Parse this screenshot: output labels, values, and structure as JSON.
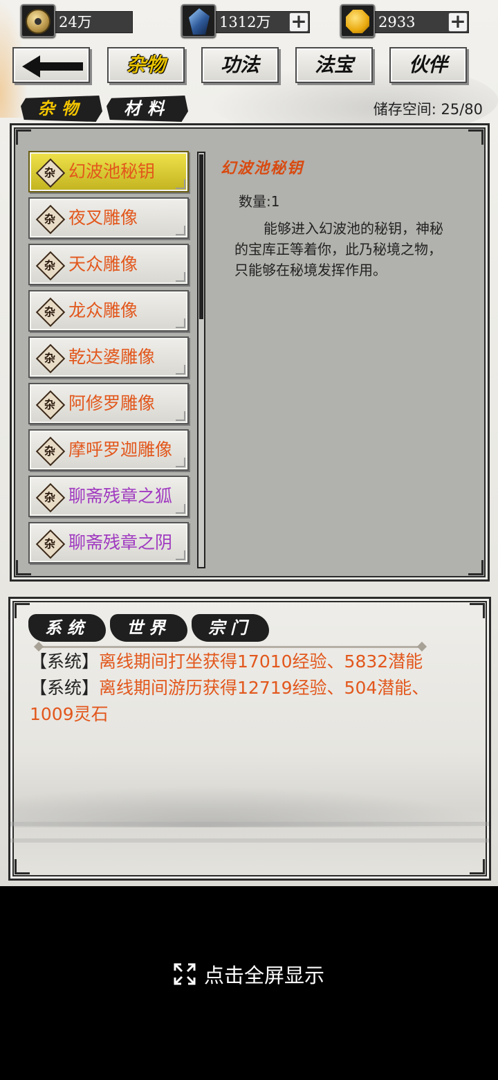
{
  "currency": {
    "coins": {
      "amount": "24万",
      "icon": "yinyang-coin-icon"
    },
    "crystals": {
      "amount": "1312万",
      "icon": "blue-crystal-icon",
      "add": "+"
    },
    "gems": {
      "amount": "2933",
      "icon": "gold-gem-icon",
      "add": "+"
    }
  },
  "top_tabs": [
    {
      "label": "",
      "icon": "back-arrow-icon"
    },
    {
      "label": "杂物",
      "active": true
    },
    {
      "label": "功法"
    },
    {
      "label": "法宝"
    },
    {
      "label": "伙伴"
    }
  ],
  "sub_tabs": [
    {
      "label": "杂物",
      "active": true
    },
    {
      "label": "材料"
    }
  ],
  "storage": "储存空间: 25/80",
  "items": [
    {
      "badge": "杂",
      "name": "幻波池秘钥",
      "selected": true,
      "color": "#e2571c"
    },
    {
      "badge": "杂",
      "name": "夜叉雕像",
      "color": "#e2571c"
    },
    {
      "badge": "杂",
      "name": "天众雕像",
      "color": "#e2571c"
    },
    {
      "badge": "杂",
      "name": "龙众雕像",
      "color": "#e2571c"
    },
    {
      "badge": "杂",
      "name": "乾达婆雕像",
      "color": "#e2571c"
    },
    {
      "badge": "杂",
      "name": "阿修罗雕像",
      "color": "#e2571c"
    },
    {
      "badge": "杂",
      "name": "摩呼罗迦雕像",
      "color": "#e2571c"
    },
    {
      "badge": "杂",
      "name": "聊斋残章之狐",
      "color": "#a03ac0"
    },
    {
      "badge": "杂",
      "name": "聊斋残章之阴",
      "color": "#a03ac0"
    }
  ],
  "detail": {
    "title": "幻波池秘钥",
    "quantity": "数量:1",
    "description": "能够进入幻波池的秘钥，神秘的宝库正等着你，此乃秘境之物，只能够在秘境发挥作用。"
  },
  "chat": {
    "tabs": [
      "系统",
      "世界",
      "宗门"
    ],
    "messages": [
      {
        "tag": "【系统】",
        "text": "离线期间打坐获得17010经验、5832潜能"
      },
      {
        "tag": "【系统】",
        "text": "离线期间游历获得12719经验、504潜能、1009灵石"
      }
    ]
  },
  "fullscreen": {
    "label": "点击全屏显示",
    "icon": "expand-icon"
  }
}
